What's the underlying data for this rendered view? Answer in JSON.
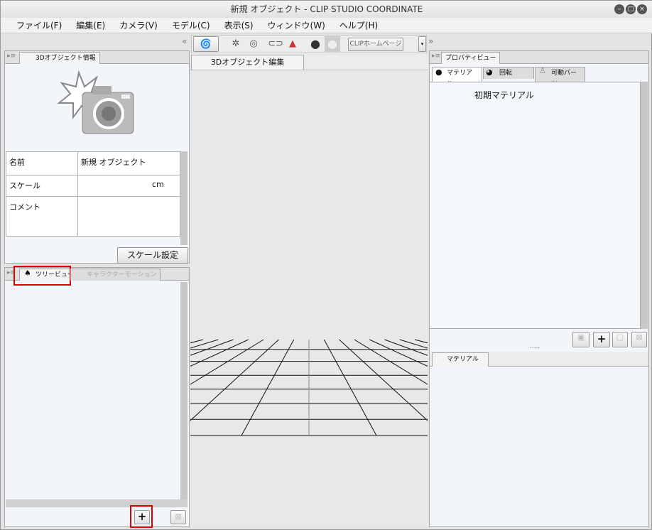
{
  "window": {
    "title": "新規 オブジェクト - CLIP STUDIO COORDINATE"
  },
  "menu": [
    "ファイル(F)",
    "編集(E)",
    "カメラ(V)",
    "モデル(C)",
    "表示(S)",
    "ウィンドウ(W)",
    "ヘルプ(H)"
  ],
  "toolbar": {
    "home_label": "CLIPホームページ"
  },
  "left": {
    "info_tab": "3Dオブジェクト情報",
    "rows": [
      {
        "label": "名前",
        "value": "新規 オブジェクト"
      },
      {
        "label": "スケール",
        "value": "cm"
      },
      {
        "label": "コメント",
        "value": ""
      }
    ],
    "scale_button": "スケール設定",
    "tree_tab": "ツリービュー",
    "motion_tab": "キャラクターモーション"
  },
  "center": {
    "tab": "3Dオブジェクト編集"
  },
  "right": {
    "prop_tab": "プロパティビュー",
    "subtabs": [
      "マテリアル",
      "回転",
      "可動パーツ"
    ],
    "materials": [
      "初期マテリアル"
    ],
    "dots": ".....",
    "bottom_tab": "マテリアル"
  },
  "highlight_color": "#e00000"
}
